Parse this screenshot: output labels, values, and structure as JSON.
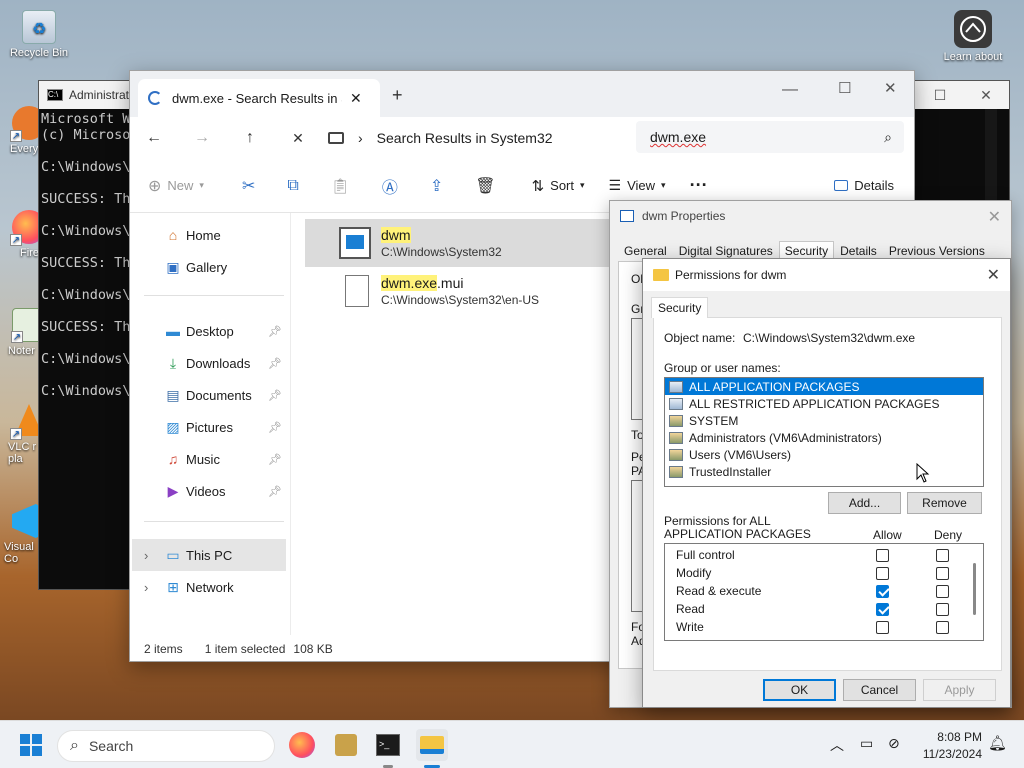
{
  "desktop": {
    "icons": [
      {
        "label": "Recycle Bin"
      },
      {
        "label": "Every"
      },
      {
        "label": "Fire"
      },
      {
        "label": "Noter"
      },
      {
        "label": "VLC r\npla"
      },
      {
        "label": "Visual\nCo"
      },
      {
        "label": "Learn about"
      }
    ]
  },
  "cmd": {
    "title": "Administrat",
    "lines": [
      "Microsoft Wi",
      "(c) Microso",
      "",
      "C:\\Windows\\S",
      "",
      "SUCCESS: The",
      "",
      "C:\\Windows\\S",
      "",
      "SUCCESS: The",
      "",
      "C:\\Windows\\S",
      "",
      "SUCCESS: The",
      "",
      "C:\\Windows\\S",
      "",
      "C:\\Windows\\S"
    ]
  },
  "explorer": {
    "tab_title": "dwm.exe - Search Results in Sy",
    "address": "Search Results in System32",
    "search_value": "dwm.exe",
    "commands": {
      "new": "New",
      "sort": "Sort",
      "view": "View",
      "details": "Details"
    },
    "sidebar": [
      {
        "label": "Home"
      },
      {
        "label": "Gallery"
      },
      {
        "label": "Desktop"
      },
      {
        "label": "Downloads"
      },
      {
        "label": "Documents"
      },
      {
        "label": "Pictures"
      },
      {
        "label": "Music"
      },
      {
        "label": "Videos"
      },
      {
        "label": "This PC"
      },
      {
        "label": "Network"
      }
    ],
    "files": [
      {
        "name": "dwm",
        "path": "C:\\Windows\\System32"
      },
      {
        "name_hl": "dwm.exe",
        "name_rest": ".mui",
        "path": "C:\\Windows\\System32\\en-US"
      }
    ],
    "status": {
      "items": "2 items",
      "selected": "1 item selected",
      "size": "108 KB"
    }
  },
  "properties": {
    "title": "dwm Properties",
    "tabs": [
      "General",
      "Digital Signatures",
      "Security",
      "Details",
      "Previous Versions"
    ],
    "peek": [
      "Ob",
      "Gro",
      "To",
      "Pe",
      "PA",
      "For",
      "Ad"
    ]
  },
  "permissions": {
    "title": "Permissions for dwm",
    "tab": "Security",
    "object_label": "Object name:",
    "object_value": "C:\\Windows\\System32\\dwm.exe",
    "group_label": "Group or user names:",
    "groups": [
      {
        "name": "ALL APPLICATION PACKAGES",
        "selected": true
      },
      {
        "name": "ALL RESTRICTED APPLICATION PACKAGES"
      },
      {
        "name": "SYSTEM"
      },
      {
        "name": "Administrators (VM6\\Administrators)"
      },
      {
        "name": "Users (VM6\\Users)"
      },
      {
        "name": "TrustedInstaller"
      }
    ],
    "add_label": "Add...",
    "remove_label": "Remove",
    "perm_label": "Permissions for ALL\nAPPLICATION PACKAGES",
    "allow_label": "Allow",
    "deny_label": "Deny",
    "rows": [
      {
        "name": "Full control",
        "allow": false,
        "deny": false
      },
      {
        "name": "Modify",
        "allow": false,
        "deny": false
      },
      {
        "name": "Read & execute",
        "allow": true,
        "deny": false
      },
      {
        "name": "Read",
        "allow": true,
        "deny": false
      },
      {
        "name": "Write",
        "allow": false,
        "deny": false
      }
    ],
    "ok_label": "OK",
    "cancel_label": "Cancel",
    "apply_label": "Apply"
  },
  "taskbar": {
    "search_placeholder": "Search",
    "time": "8:08 PM",
    "date": "11/23/2024"
  },
  "colors": {
    "accent": "#0078d7",
    "highlight": "#fff27a"
  }
}
